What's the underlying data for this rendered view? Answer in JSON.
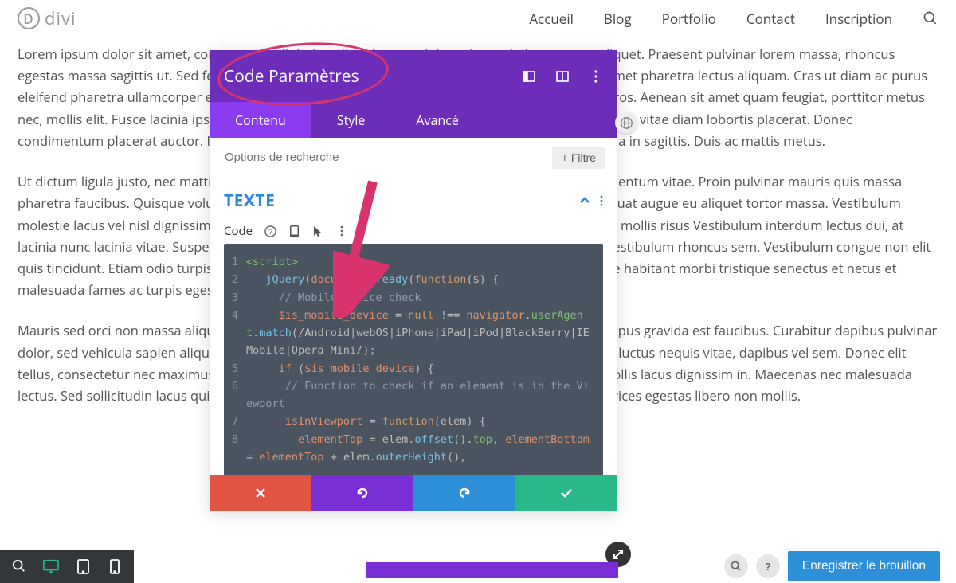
{
  "logo_text": "divi",
  "nav": [
    "Accueil",
    "Blog",
    "Portfolio",
    "Contact",
    "Inscription"
  ],
  "paragraphs": [
    "Lorem ipsum dolor sit amet, consectetur adipiscing elit. Etiam suscipit sapien sed diam congue aliquet. Praesent pulvinar lorem massa, rhoncus egestas massa sagittis ut. Sed felis arcu, lacinia sed urna vitae, varius tempor justo. Curabitur sit amet pharetra lectus aliquam. Cras ut diam ac purus eleifend pharetra ullamcorper eu ipsum Aenean aliquam purus eget orci ultricies, eget tincidunt eros. Aenean sit amet quam feugiat, porttitor metus nec, mollis elit. Fusce lacinia ipsum at erat accumsan tempus. Donec vel dolor sed ales. Nam sed nibh vitae diam lobortis placerat. Donec condimentum placerat auctor. In lectus purus, tristique id ac, dictum sed elit. Sed et gravida at nulla in sagittis. Duis ac mattis metus.",
    "Ut dictum ligula justo, nec mattis tellus mattis non. Duis euismod erat vitae dapibus. Quisque fermentum vitae. Proin pulvinar mauris quis massa pharetra faucibus. Quisque volutpat quam lorem. Aliquam dictum velit ac nisl laoreet, quis consequat augue eu aliquet tortor massa. Vestibulum molestie lacus vel nisl dignissim commodo. Pellentesque dapibus tellus at felis commodo, sit amet mollis risus Vestibulum interdum lectus dui, at lacinia nunc lacinia vitae. Suspendisse porta fermentum orci, nec pharetra dui interdum at. Duis vestibulum rhoncus sem. Vestibulum congue non elit quis tincidunt. Etiam odio turpis, bibendum vel sapien interdum, tempor luctus enim. Pellentesque habitant morbi tristique senectus et netus et malesuada fames ac turpis egestas.",
    "Mauris sed orci non massa aliquam luctus. Morbi at nibh eu tellus vestibulum euismod. Morbi tempus gravida est faucibus. Curabitur dapibus pulvinar dolor, sed vehicula sapien aliquet eu. Morbi rhoncus justo erat, vitae finibus urna tincidunt a. Duis luctus nequis vitae, dapibus vel sem. Donec elit tellus, consectetur nec maximus ut, ornare sit amet neque. Nam ut augue eget mauris posuere mollis lacus dignissim in. Maecenas nec malesuada lectus. Sed sollicitudin lacus quis lorem suscipit porttitor. In feugiat mattis massa et rutrum. Ut ultrices egestas libero non mollis."
  ],
  "modal": {
    "title": "Code Paramètres",
    "tabs": [
      "Contenu",
      "Style",
      "Avancé"
    ],
    "active_tab": 0,
    "search_placeholder": "Options de recherche",
    "filter_label": "Filtre",
    "section_title": "TEXTE",
    "field_label": "Code"
  },
  "code_lines": [
    {
      "n": "1",
      "html": "<span class='tok-tag'>&lt;script&gt;</span>"
    },
    {
      "n": "2",
      "html": "   <span class='tok-fn'>jQuery</span><span class='tok-punc'>(</span><span class='tok-var'>document</span><span class='tok-punc'>).</span><span class='tok-fn'>ready</span><span class='tok-punc'>(</span><span class='tok-kw'>function</span><span class='tok-punc'>($) {</span>"
    },
    {
      "n": "3",
      "html": "     <span class='tok-comment'>// Mobile device check</span>"
    },
    {
      "n": "4",
      "html": "     <span class='tok-var'>$is_mobile_device</span> <span class='tok-punc'>=</span> <span class='tok-kw'>null</span> <span class='tok-punc'>!==</span> <span class='tok-var'>navigator</span><span class='tok-punc'>.</span><span class='tok-prop'>userAgent</span><span class='tok-punc'>.</span><span class='tok-fn'>match</span><span class='tok-punc'>(</span><span class='tok-str'>/Android|webOS|iPhone|iPad|iPod|BlackBerry|IEMobile|Opera Mini/</span><span class='tok-punc'>);</span>"
    },
    {
      "n": "5",
      "html": "     <span class='tok-kw'>if</span> <span class='tok-punc'>(</span><span class='tok-var'>$is_mobile_device</span><span class='tok-punc'>) {</span>"
    },
    {
      "n": "6",
      "html": "      <span class='tok-comment'>// Function to check if an element is in the Viewport</span>"
    },
    {
      "n": "7",
      "html": "      <span class='tok-var'>isInViewport</span> <span class='tok-punc'>=</span> <span class='tok-kw'>function</span><span class='tok-punc'>(elem) {</span>"
    },
    {
      "n": "8",
      "html": "        <span class='tok-var'>elementTop</span> <span class='tok-punc'>=</span> <span class='tok-str'>elem</span><span class='tok-punc'>.</span><span class='tok-fn'>offset</span><span class='tok-punc'>().</span><span class='tok-prop'>top</span><span class='tok-punc'>,</span> <span class='tok-var'>elementBottom</span> <span class='tok-punc'>=</span> <span class='tok-var'>elementTop</span> <span class='tok-punc'>+</span> <span class='tok-str'>elem</span><span class='tok-punc'>.</span><span class='tok-fn'>outerHeight</span><span class='tok-punc'>(),</span>"
    }
  ],
  "bottombar": {
    "save_draft": "Enregistrer le brouillon"
  }
}
